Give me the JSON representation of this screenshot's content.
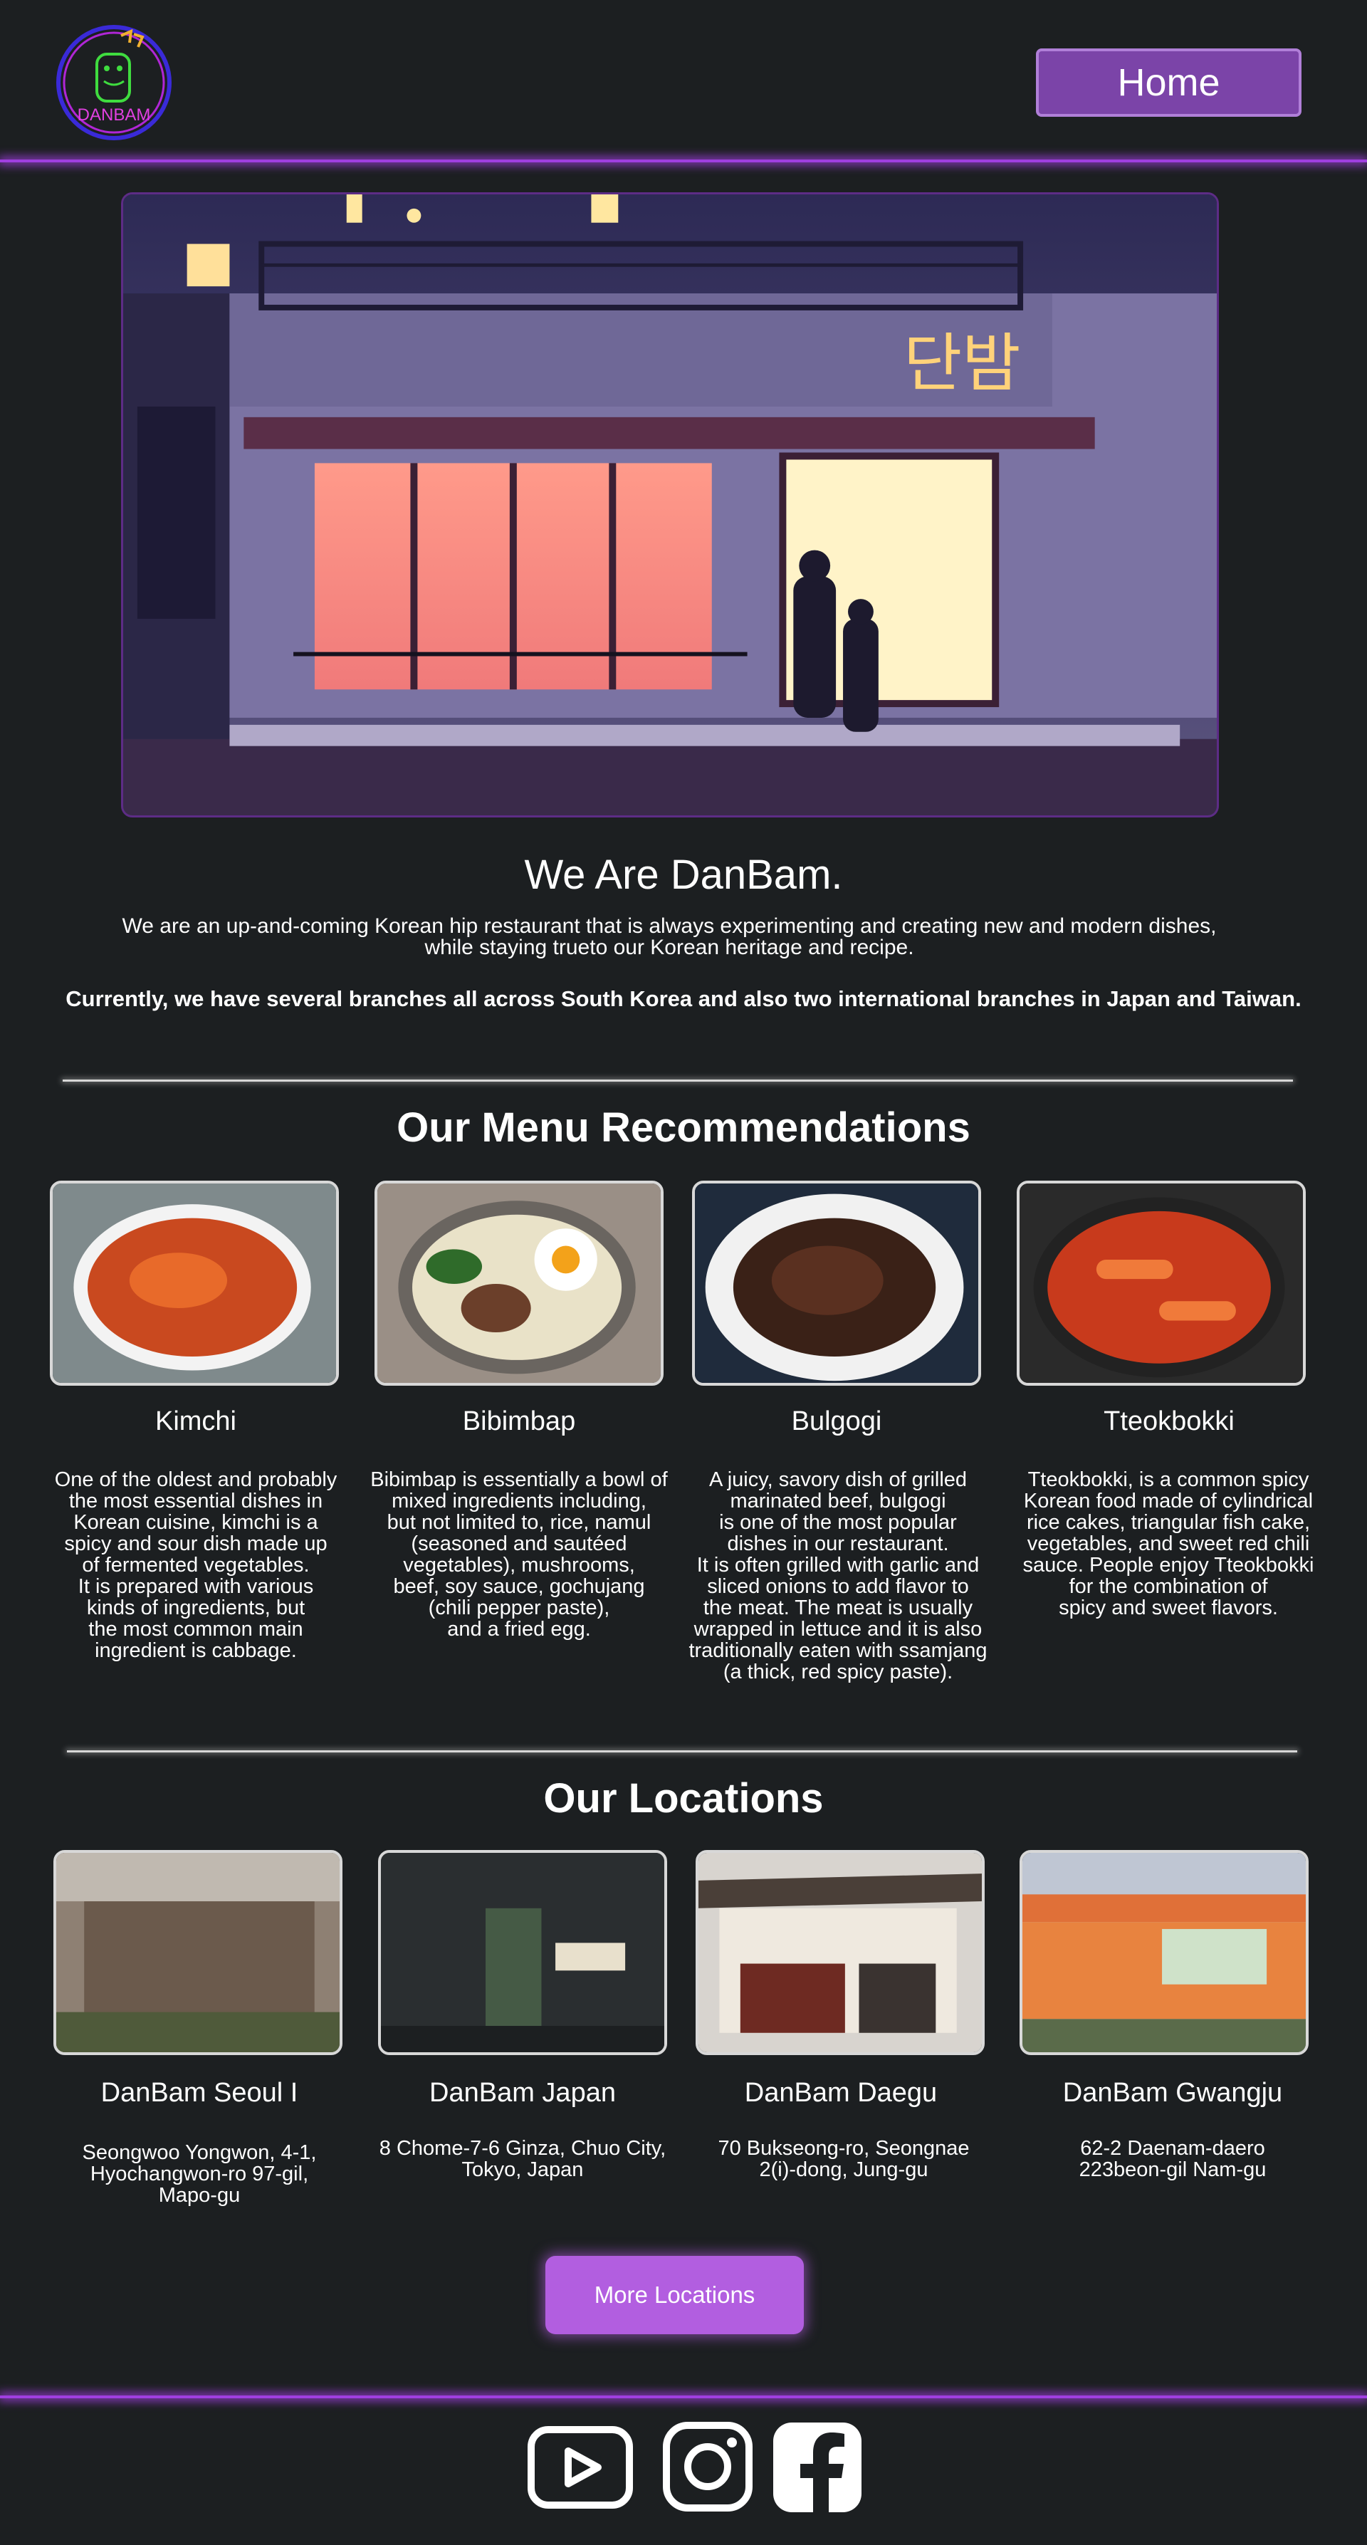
{
  "header": {
    "logo_text": "DANBAM",
    "logo_hangul": "단밤",
    "home_label": "Home"
  },
  "hero": {
    "sign_hangul": "단밤"
  },
  "intro": {
    "title": "We Are DanBam.",
    "text": "We are an up-and-coming Korean hip restaurant that is always experimenting and creating new and modern dishes, while staying trueto our Korean heritage and recipe.",
    "branches": "Currently, we have several branches all across South Korea and also two international branches in Japan and Taiwan."
  },
  "menu": {
    "title": "Our Menu Recommendations",
    "items": [
      {
        "name": "Kimchi",
        "desc": "One of the oldest and probably\nthe most essential dishes in\nKorean cuisine, kimchi is a\nspicy and sour dish made up\nof fermented vegetables.\nIt is prepared with various\nkinds of ingredients, but\nthe most common main\ningredient is cabbage."
      },
      {
        "name": "Bibimbap",
        "desc": "Bibimbap is essentially a bowl of\nmixed ingredients including,\nbut not limited to, rice, namul\n(seasoned and sautéed\nvegetables), mushrooms,\nbeef, soy sauce, gochujang\n(chili pepper paste),\nand a fried egg."
      },
      {
        "name": "Bulgogi",
        "desc": "A juicy, savory dish of grilled\nmarinated beef, bulgogi\nis one of the most popular\ndishes in our restaurant.\nIt is often grilled with garlic and\nsliced onions to add flavor to\nthe meat. The meat is usually\nwrapped in lettuce and it is also\ntraditionally eaten with ssamjang\n(a thick, red spicy paste)."
      },
      {
        "name": "Tteokbokki",
        "desc": "Tteokbokki, is a common spicy\nKorean food made of cylindrical\nrice cakes, triangular fish cake,\nvegetables, and sweet red chili\nsauce. People enjoy Tteokbokki\nfor the combination of\nspicy and sweet flavors."
      }
    ]
  },
  "locations": {
    "title": "Our Locations",
    "items": [
      {
        "name": "DanBam Seoul I",
        "address": "Seongwoo Yongwon, 4-1,\nHyochangwon-ro 97-gil,\nMapo-gu"
      },
      {
        "name": "DanBam Japan",
        "address": "8 Chome-7-6 Ginza, Chuo City,\nTokyo, Japan"
      },
      {
        "name": "DanBam Daegu",
        "address": "70 Bukseong-ro, Seongnae\n2(i)-dong, Jung-gu"
      },
      {
        "name": "DanBam Gwangju",
        "address": "62-2 Daenam-daero\n223beon-gil Nam-gu"
      }
    ],
    "more_label": "More Locations"
  },
  "footer": {
    "social": [
      "youtube-icon",
      "instagram-icon",
      "facebook-icon"
    ]
  },
  "colors": {
    "background": "#1c1f21",
    "accent": "#a03fe0",
    "button": "#b25ee0",
    "home_button": "#7b44a8"
  }
}
